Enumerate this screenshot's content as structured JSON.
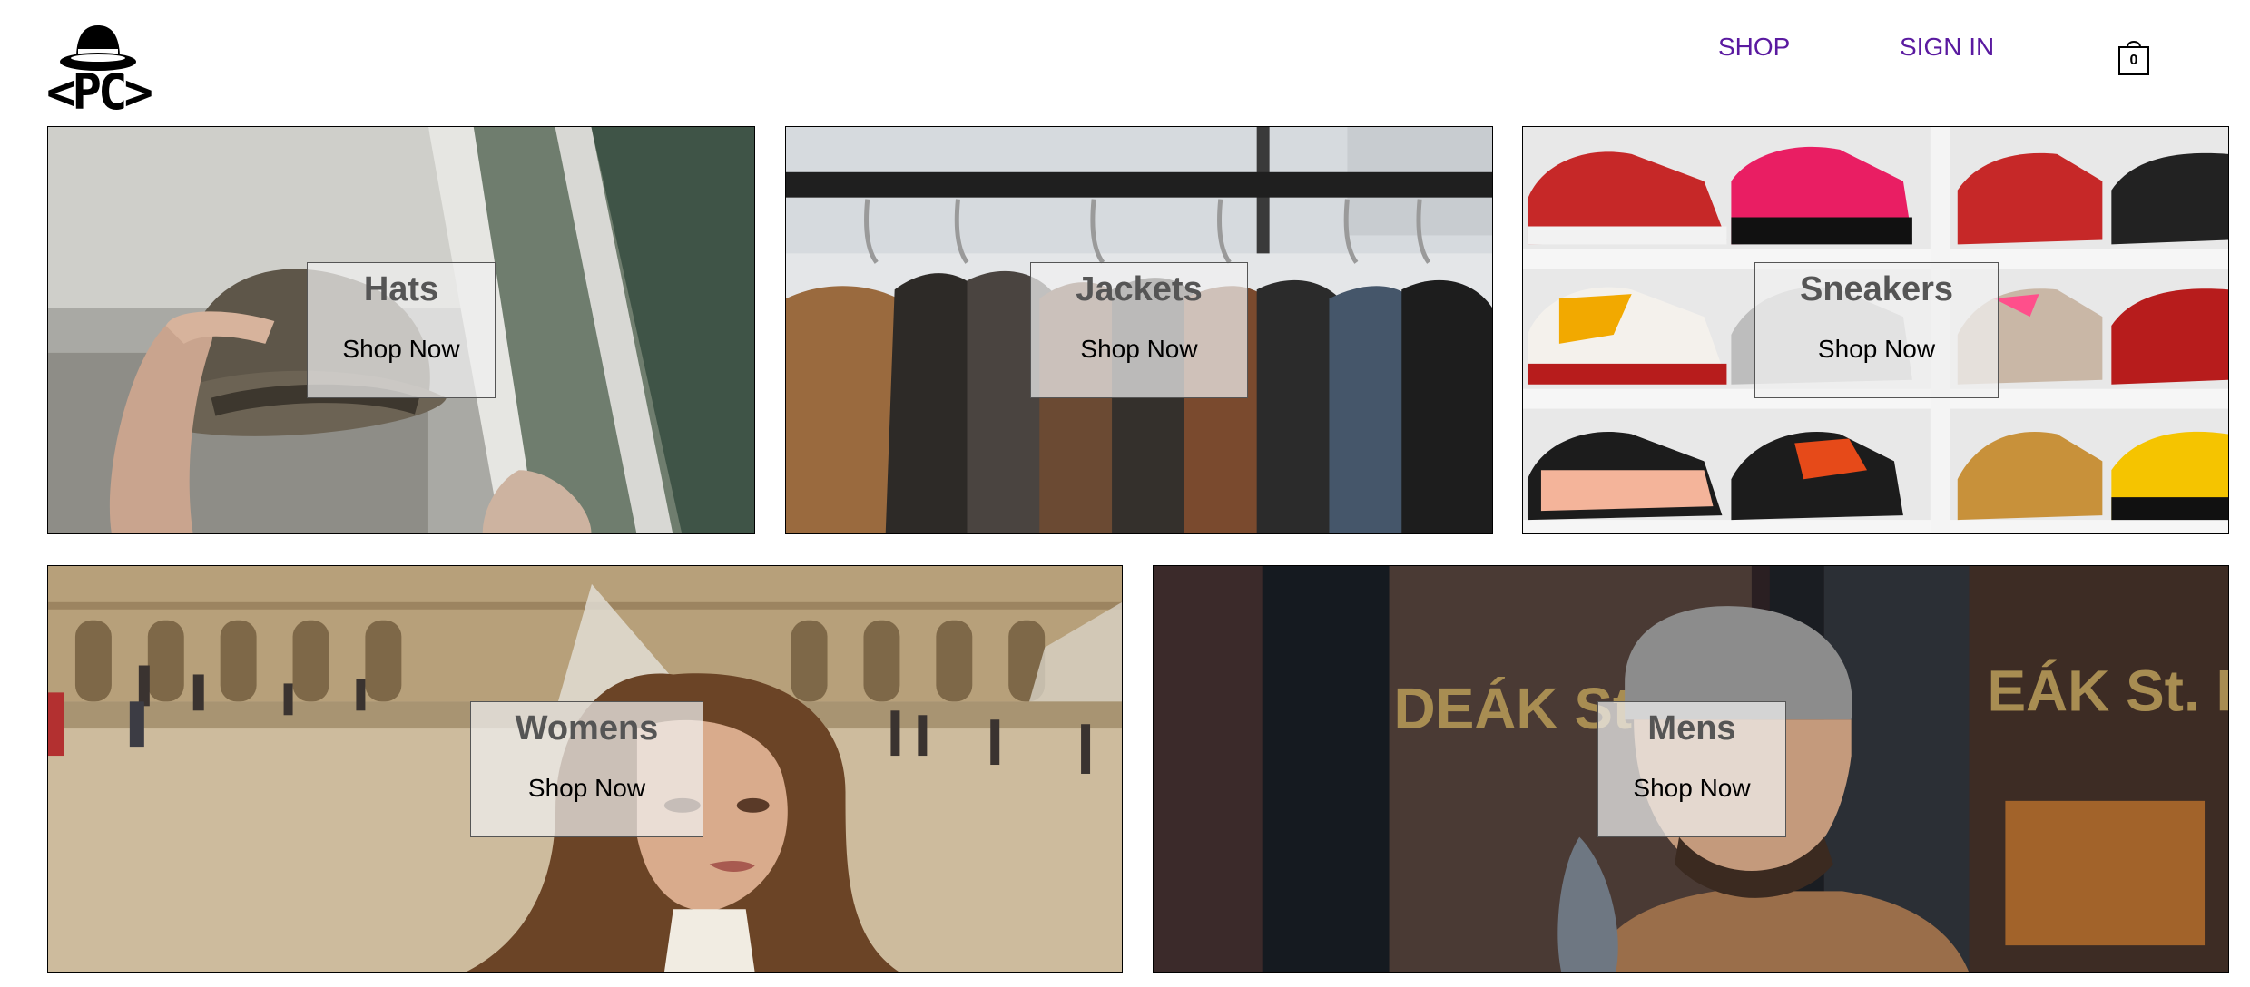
{
  "header": {
    "logo_text": "<PC>",
    "nav": {
      "shop": "SHOP",
      "sign_in": "SIGN IN"
    },
    "cart": {
      "count": "0",
      "icon": "shopping-bag-icon"
    }
  },
  "categories": [
    {
      "title": "Hats",
      "cta": "Shop Now",
      "image": "man-adjusting-fedora-hat"
    },
    {
      "title": "Jackets",
      "cta": "Shop Now",
      "image": "leather-jackets-on-rack"
    },
    {
      "title": "Sneakers",
      "cta": "Shop Now",
      "image": "sneakers-on-shelves"
    },
    {
      "title": "Womens",
      "cta": "Shop Now",
      "image": "woman-in-plaza"
    },
    {
      "title": "Mens",
      "cta": "Shop Now",
      "image": "man-in-beanie"
    }
  ],
  "colors": {
    "nav_link": "#5a1aa0",
    "title_text": "#555555",
    "overlay": "rgba(240,240,240,0.72)"
  }
}
